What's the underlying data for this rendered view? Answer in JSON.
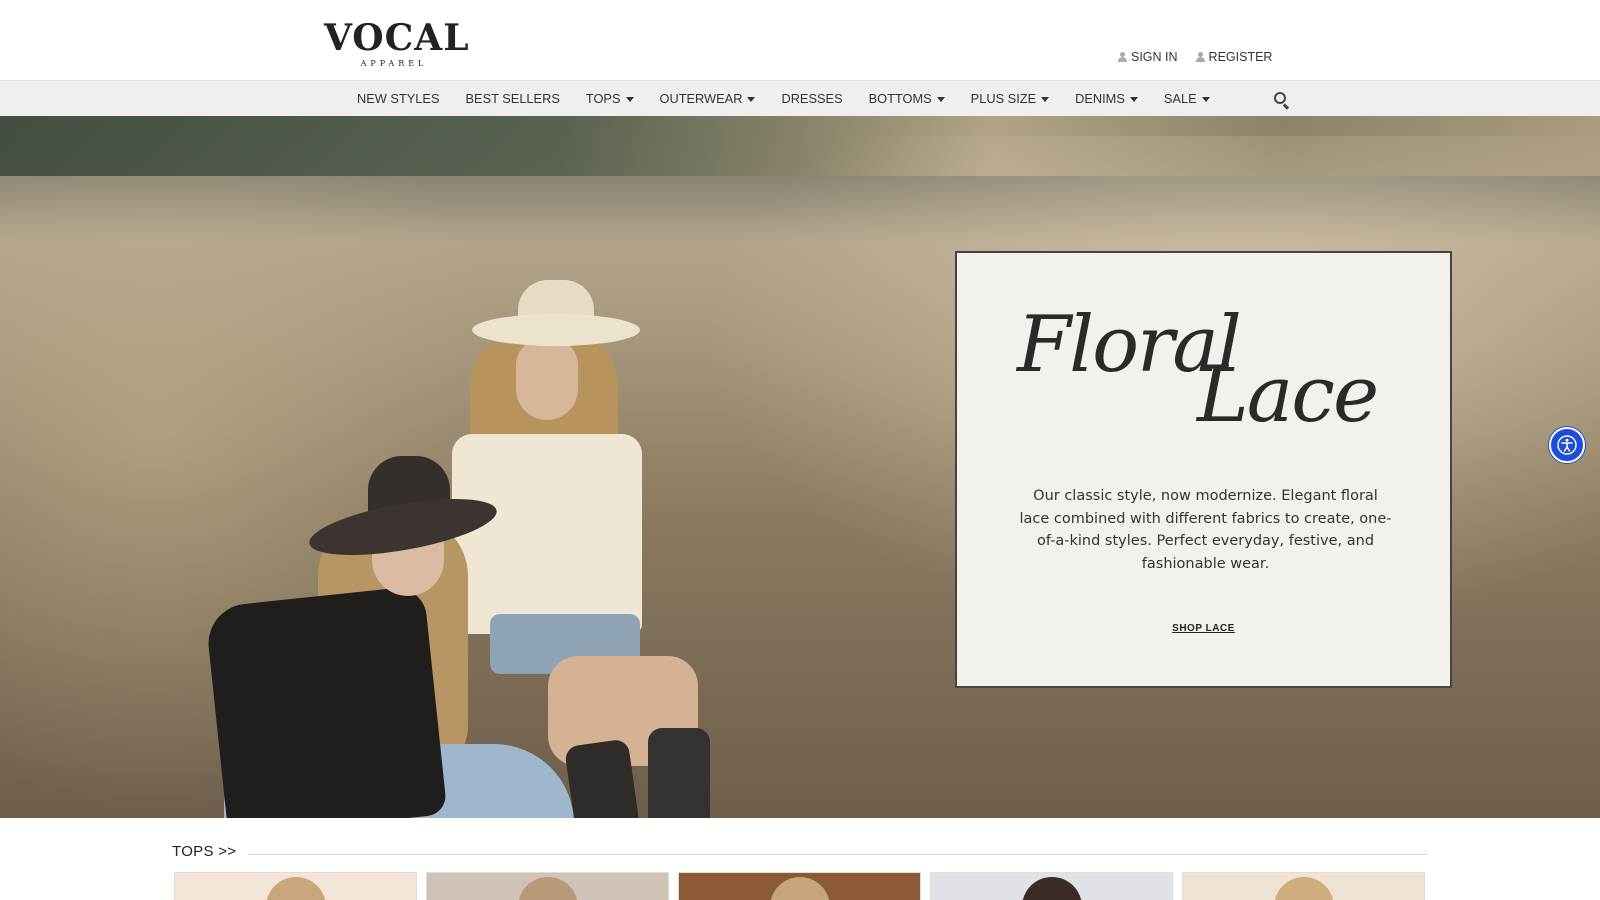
{
  "brand": {
    "name": "VOCAL",
    "tagline": "APPAREL"
  },
  "account": {
    "sign_in": "SIGN IN",
    "register": "REGISTER"
  },
  "nav": {
    "items": [
      {
        "label": "NEW STYLES",
        "dropdown": false
      },
      {
        "label": "BEST SELLERS",
        "dropdown": false
      },
      {
        "label": "TOPS",
        "dropdown": true
      },
      {
        "label": "OUTERWEAR",
        "dropdown": true
      },
      {
        "label": "DRESSES",
        "dropdown": false
      },
      {
        "label": "BOTTOMS",
        "dropdown": true
      },
      {
        "label": "PLUS SIZE",
        "dropdown": true
      },
      {
        "label": "DENIMS",
        "dropdown": true
      },
      {
        "label": "SALE",
        "dropdown": true
      }
    ],
    "search_icon": "search-icon"
  },
  "hero": {
    "title_line1": "Floral",
    "title_line2": "Lace",
    "body": "Our classic style, now modernize. Elegant floral lace combined with different fabrics to create, one-of-a-kind styles. Perfect everyday, festive, and fashionable wear.",
    "cta": "SHOP LACE"
  },
  "accessibility": {
    "icon": "accessibility-icon",
    "color": "#1c4ed8"
  },
  "section": {
    "title": "TOPS >>",
    "thumbs": [
      {
        "bg": "#f3e5d8",
        "accent": "#c9a77a"
      },
      {
        "bg": "#cfc2b6",
        "accent": "#b89a78"
      },
      {
        "bg": "#8a5a36",
        "accent": "#c7a47c"
      },
      {
        "bg": "#dfe2e6",
        "accent": "#3a2c24"
      },
      {
        "bg": "#efe3d3",
        "accent": "#cfad7e"
      }
    ]
  }
}
